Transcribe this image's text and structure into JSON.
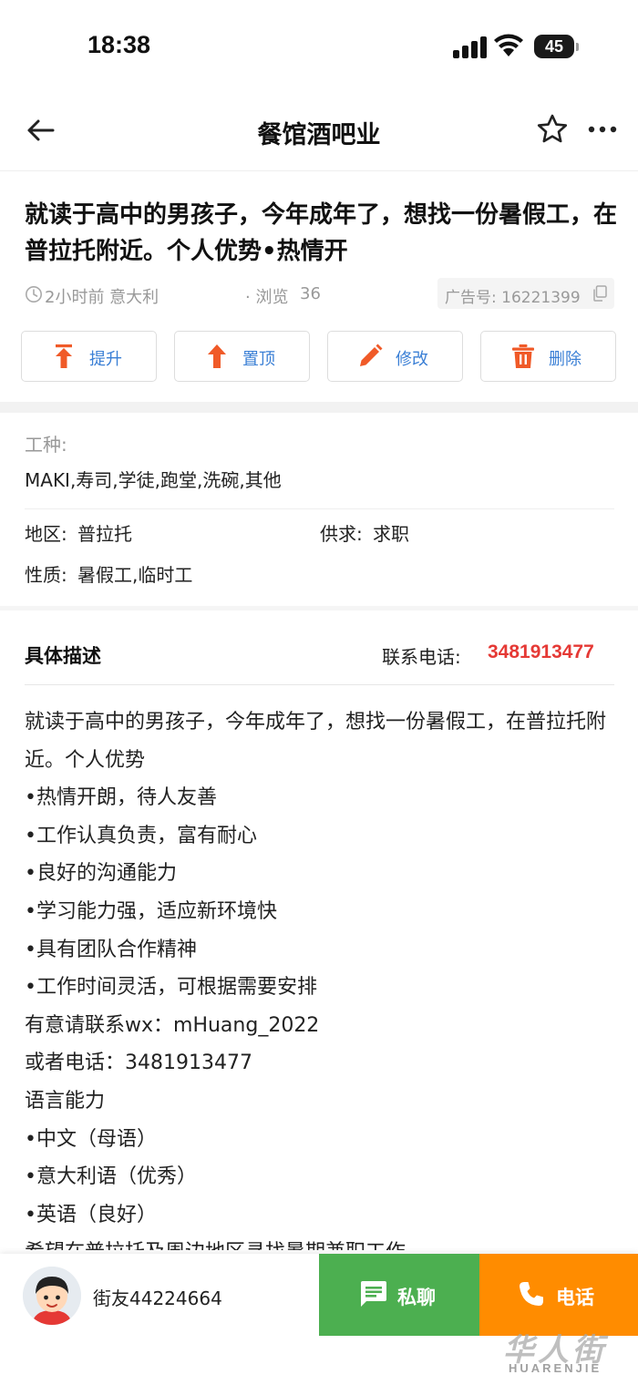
{
  "status": {
    "time": "18:38",
    "battery": "45"
  },
  "nav": {
    "title": "餐馆酒吧业"
  },
  "post": {
    "title": "就读于高中的男孩子，今年成年了，想找一份暑假工，在普拉托附近。个人优势•热情开",
    "time_location": "2小时前 意大利",
    "views_label": "· 浏览",
    "views_count": "36",
    "ad_number": "广告号: 16221399"
  },
  "actions": [
    {
      "label": "提升",
      "icon": "boost-up-icon"
    },
    {
      "label": "置顶",
      "icon": "pin-top-icon"
    },
    {
      "label": "修改",
      "icon": "pencil-icon"
    },
    {
      "label": "删除",
      "icon": "trash-icon"
    }
  ],
  "info": {
    "job_type_label": "工种:",
    "job_type_value": "MAKI,寿司,学徒,跑堂,洗碗,其他",
    "region_label": "地区:",
    "region_value": "普拉托",
    "supply_label": "供求:",
    "supply_value": "求职",
    "nature_label": "性质:",
    "nature_value": "暑假工,临时工"
  },
  "description": {
    "heading": "具体描述",
    "contact_label": "联系电话:",
    "contact_phone": "3481913477",
    "lines": [
      "就读于高中的男孩子，今年成年了，想找一份暑假工，在普拉托附近。个人优势",
      "•热情开朗，待人友善",
      "•工作认真负责，富有耐心",
      "•良好的沟通能力",
      "•学习能力强，适应新环境快",
      "•具有团队合作精神",
      "•工作时间灵活，可根据需要安排",
      "有意请联系wx：mHuang_2022",
      "或者电话：3481913477",
      "语言能力",
      "•中文（母语）",
      "•意大利语（优秀）",
      "•英语（良好）",
      "希望在普拉托及周边地区寻找暑期兼职工作"
    ]
  },
  "bottom": {
    "username": "街友44224664",
    "chat_label": "私聊",
    "call_label": "电话",
    "watermark_cn": "华人街",
    "watermark_en": "HUARENJIE"
  },
  "colors": {
    "accent_blue": "#3a7fd5",
    "icon_red": "#f05a28",
    "phone_red": "#e53935",
    "chat_green": "#4caf50",
    "call_orange": "#ff8c00"
  }
}
